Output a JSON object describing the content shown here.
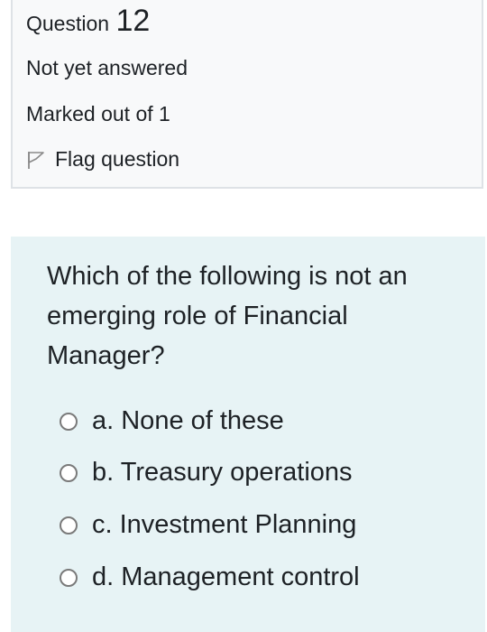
{
  "question_info": {
    "label": "Question",
    "number": "12",
    "state": "Not yet answered",
    "grade": "Marked out of 1",
    "flag_label": "Flag question"
  },
  "question": {
    "text": "Which of the following is not an emerging role of Financial Manager?",
    "options": [
      {
        "label": "a. None of these",
        "selected": false
      },
      {
        "label": "b. Treasury operations",
        "selected": false
      },
      {
        "label": "c. Investment Planning",
        "selected": false
      },
      {
        "label": "d. Management control",
        "selected": false
      }
    ]
  },
  "colors": {
    "info_background": "#f8f9fa",
    "info_border": "#dee2e6",
    "question_background": "#e7f3f5",
    "text": "#1d2125"
  },
  "icons": {
    "flag": "flag-icon",
    "radio": "radio-button-unchecked"
  }
}
